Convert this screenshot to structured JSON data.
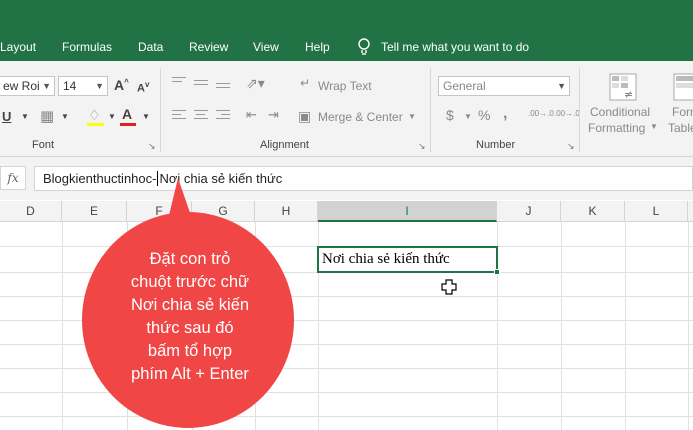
{
  "ribbon_tabs": [
    "Layout",
    "Formulas",
    "Data",
    "Review",
    "View",
    "Help"
  ],
  "tell_me": "Tell me what you want to do",
  "font": {
    "name": "ew Roi",
    "size": "14"
  },
  "alignment": {
    "wrap_text": "Wrap Text",
    "merge_center": "Merge & Center"
  },
  "number": {
    "format": "General",
    "currency": "$",
    "percent": "%",
    "comma": ",",
    "inc_decimal": ".00→.0",
    "dec_decimal": ".00→.0"
  },
  "styles": {
    "conditional_1": "Conditional",
    "conditional_2": "Formatting",
    "format_table_1": "Forma",
    "format_table_2": "Table"
  },
  "group_labels": {
    "font": "Font",
    "alignment": "Alignment",
    "number": "Number"
  },
  "formula_bar": {
    "fx": "fx",
    "text_before": "Blogkienthuctinhoc-",
    "text_after": "Nơi chia sẻ kiến thức"
  },
  "columns": [
    "D",
    "E",
    "F",
    "G",
    "H",
    "I",
    "J",
    "K",
    "L"
  ],
  "active_cell_value": "Nơi chia sẻ kiến thức",
  "callout_lines": [
    "Đặt con trỏ",
    "chuột trước chữ",
    "Nơi chia sẻ kiến",
    "thức sau đó",
    "bấm tổ hợp",
    "phím Alt + Enter"
  ],
  "colors": {
    "excel_green": "#217346",
    "callout_red": "#f04646"
  }
}
